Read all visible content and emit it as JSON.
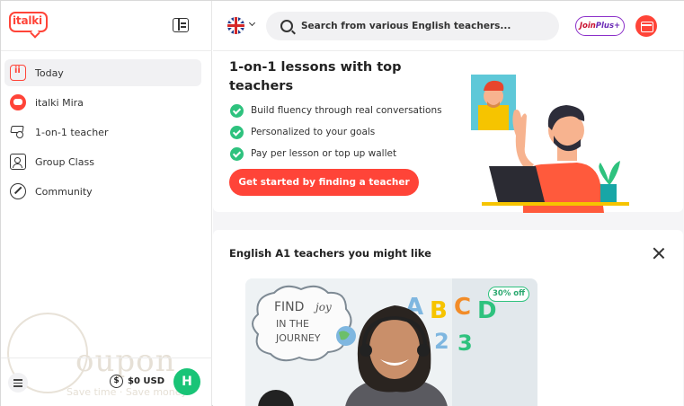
{
  "sidebar": {
    "logo": "italki",
    "items": [
      {
        "label": "Today",
        "active": true,
        "icon": "today-icon"
      },
      {
        "label": "italki Mira",
        "active": false,
        "icon": "mira-icon"
      },
      {
        "label": "1-on-1 teacher",
        "active": false,
        "icon": "teacher-search-icon"
      },
      {
        "label": "Group Class",
        "active": false,
        "icon": "group-class-icon"
      },
      {
        "label": "Community",
        "active": false,
        "icon": "community-icon"
      }
    ],
    "wallet": "$0 USD",
    "wallet_symbol": "$",
    "avatar_initial": "H",
    "watermark": {
      "text": "oupon",
      "sub": "Save time · Save money"
    }
  },
  "header": {
    "language_flag": "uk-flag-icon",
    "search_placeholder": "Search from various English teachers...",
    "join_plus": {
      "join": "Join",
      "plus": "Plus+"
    }
  },
  "promo": {
    "title": "1-on-1 lessons with top teachers",
    "bullets": [
      "Build fluency through real conversations",
      "Personalized to your goals",
      "Pay per lesson or top up wallet"
    ],
    "cta": "Get started by finding a teacher"
  },
  "teachers": {
    "title": "English A1 teachers you might like",
    "discount": "30% off",
    "board_lines": [
      "FIND",
      "joy",
      "IN THE",
      "JOURNEY"
    ],
    "board_letters": [
      "A",
      "B",
      "C",
      "D",
      "2",
      "3"
    ]
  },
  "colors": {
    "brand": "#ff4438",
    "check": "#2ec27e",
    "avatar": "#19c477"
  }
}
